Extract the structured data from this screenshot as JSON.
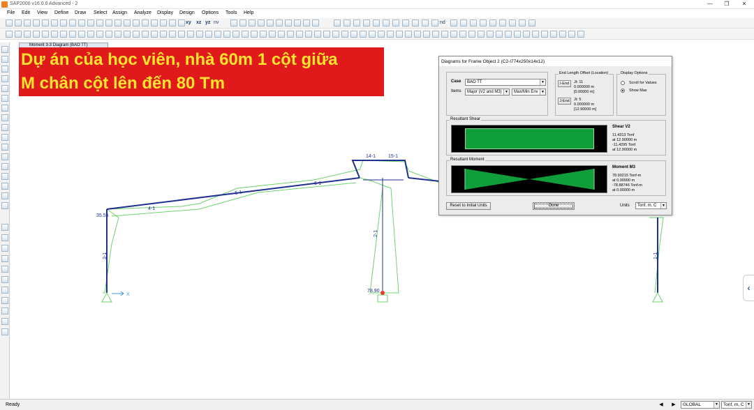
{
  "window": {
    "title": "SAP2000 v16.0.0 Advanced - 2",
    "controls": [
      "—",
      "❐",
      "✕"
    ]
  },
  "menu": [
    "File",
    "Edit",
    "View",
    "Define",
    "Draw",
    "Select",
    "Assign",
    "Analyze",
    "Display",
    "Design",
    "Options",
    "Tools",
    "Help"
  ],
  "toolbar": {
    "view_labels": [
      "xy",
      "xz",
      "yz",
      "nv"
    ],
    "nd_label": "nd"
  },
  "doc_tab": "Moment 3-3 Diagram  (BAO TT)",
  "banner": {
    "line1": "Dự án của học viên, nhà 60m 1 cột giữa",
    "line2": "M chân cột lên đến 80 Tm"
  },
  "model": {
    "left_value": "35.55",
    "middle_value": "78.90",
    "axis_label": "X",
    "labels": [
      "4-1",
      "5-1",
      "6-1",
      "2-1",
      "14-1",
      "15-1",
      "3-1",
      "1-1",
      "1-1"
    ]
  },
  "dialog": {
    "title": "Diagrams for Frame Object 2  (C2-I774x250x14x12)",
    "case_label": "Case",
    "case_value": "BAO TT",
    "items_label": "Items",
    "items_value": "Major (V2 and M3)",
    "env_value": "Max/Min Env",
    "end_offset_title": "End Length Offset (Location)",
    "i_end": {
      "button": "I-End",
      "jt": "Jt:  11",
      "v1": "0.000000 m",
      "v2": "[0.00000 m]"
    },
    "j_end": {
      "button": "J-End",
      "jt": "Jt:  5",
      "v1": "0.000000 m",
      "v2": "[12.90000 m]"
    },
    "display_options_title": "Display Options",
    "scroll_label": "Scroll for Values",
    "showmax_label": "Show Max",
    "display_selected": "Show Max",
    "shear": {
      "group": "Resultant Shear",
      "title": "Shear V2",
      "v1": "11.4313 Tonf",
      "l1": "at 12.90000 m",
      "v2": "-11.4295 Tonf",
      "l2": "at 12.90000 m"
    },
    "moment": {
      "group": "Resultant Moment",
      "title": "Moment M3",
      "v1": "78.90215 Tonf-m",
      "l1": "at 0.00000 m",
      "v2": "-78.88746 Tonf-m",
      "l2": "at 0.00000 m"
    },
    "reset_button": "Reset to Initial Units",
    "done_button": "Done",
    "units_label": "Units",
    "units_value": "Tonf, m, C",
    "diagram_color": "#0f9e3a"
  },
  "status": {
    "text": "Ready",
    "coord_system": "GLOBAL",
    "units": "Tonf, m, C"
  },
  "colors": {
    "banner_bg": "#e01a1a",
    "banner_text": "#ffe32e",
    "frame": "#1f2f8f",
    "diagram": "#6cd46c"
  }
}
